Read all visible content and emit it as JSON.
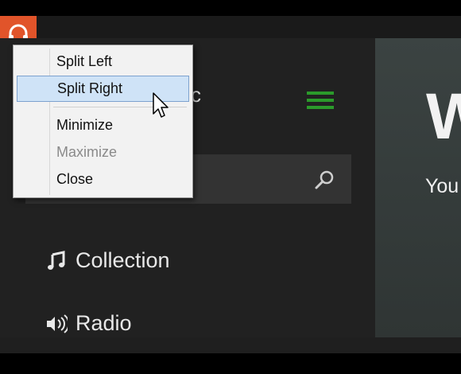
{
  "app": {
    "title_tail": "c",
    "icon": "headphones-icon",
    "accent": "#e1542a",
    "hamburger_color": "#2b9a2b"
  },
  "search": {
    "value": "",
    "placeholder": ""
  },
  "nav": [
    {
      "label": "Collection",
      "icon": "music-note-icon"
    },
    {
      "label": "Radio",
      "icon": "radio-waves-icon"
    }
  ],
  "content": {
    "big_text": "W",
    "sub_text": "You"
  },
  "context_menu": {
    "items": [
      {
        "label": "Split Left",
        "state": "normal"
      },
      {
        "label": "Split Right",
        "state": "hover"
      },
      {
        "label": "Minimize",
        "state": "normal"
      },
      {
        "label": "Maximize",
        "state": "disabled"
      },
      {
        "label": "Close",
        "state": "normal"
      }
    ]
  }
}
